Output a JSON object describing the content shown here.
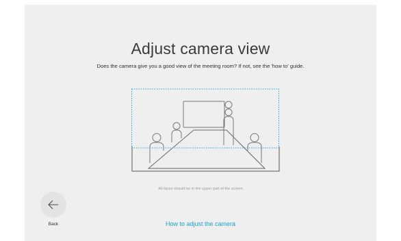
{
  "page": {
    "title": "Adjust camera view",
    "subtitle": "Does the camera give you a good view of the meeting room? If not, see the 'how to' guide.",
    "hint": "All faces should be in the upper part of the screen",
    "back_label": "Back",
    "link_label": "How to adjust the camera"
  },
  "icons": {
    "back": "arrow-left-icon",
    "illustration": "meeting-room-illustration"
  },
  "colors": {
    "background": "#efefef",
    "link": "#1aa3d6",
    "guide_line": "#1aa3d6",
    "button_bg": "#e3e3e3"
  }
}
